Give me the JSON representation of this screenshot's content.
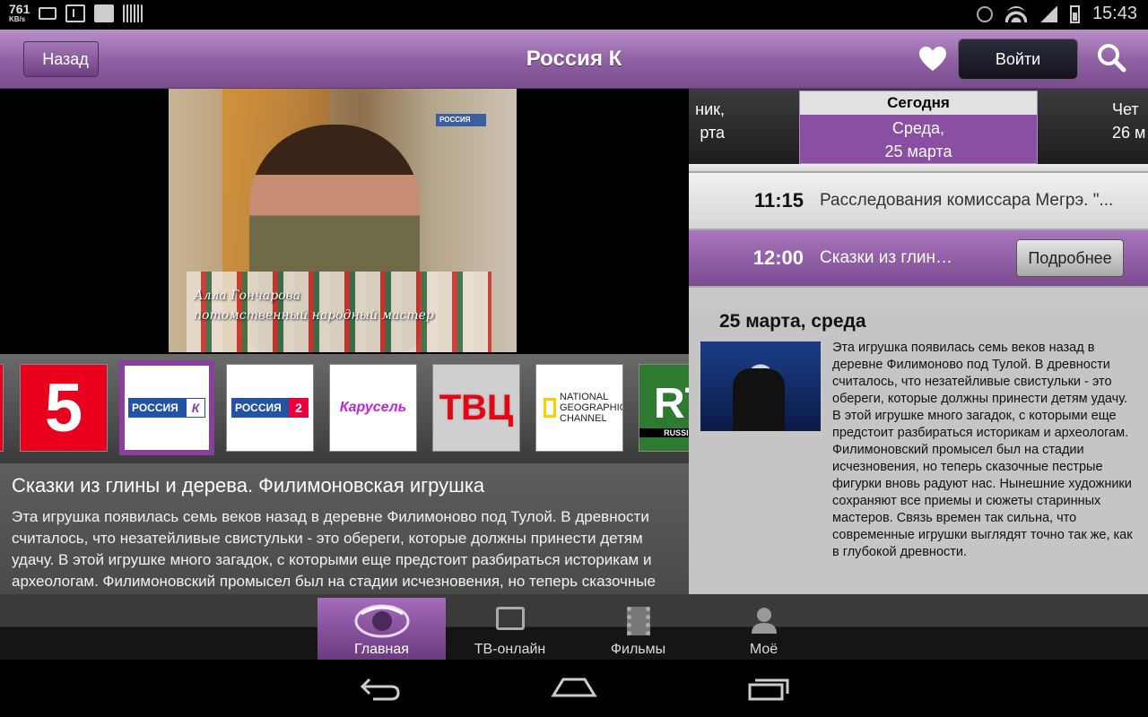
{
  "status_bar": {
    "speed_value": "761",
    "speed_unit": "KB/s",
    "time": "15:43"
  },
  "header": {
    "back_label": "Назад",
    "title": "Россия К",
    "login_label": "Войти"
  },
  "video": {
    "caption_line1": "Алла Гончарова",
    "caption_line2": "потомственный народный мастер",
    "channel_logo": "РОССИЯ"
  },
  "channels": [
    {
      "name": "5",
      "label": "5"
    },
    {
      "name": "russia-k",
      "label": "РОССИЯ",
      "tag": "К"
    },
    {
      "name": "russia-2",
      "label": "РОССИЯ",
      "tag": "2"
    },
    {
      "name": "karusel",
      "label": "Карусель"
    },
    {
      "name": "tvc",
      "label": "ТВ",
      "tag": "Ц"
    },
    {
      "name": "natgeo",
      "label": "NATIONAL GEOGRAPHIC CHANNEL"
    },
    {
      "name": "rt",
      "label": "RT",
      "tag": "RUSSIA T"
    }
  ],
  "description": {
    "title": "Сказки из глины и дерева. Филимоновская игрушка",
    "text": "Эта игрушка появилась семь веков назад в деревне Филимоново под Тулой. В древности считалось, что незатейливые свистульки - это обереги, которые должны принести детям удачу. В этой игрушке много загадок, с которыми еще предстоит разбираться историкам и археологам. Филимоновский промысел был на стадии исчезновения, но теперь сказочные пестрые фигурки вновь радуют нас."
  },
  "days": {
    "prev_line1": "ник,",
    "prev_line2": "рта",
    "today_label": "Сегодня",
    "today_line1": "Среда,",
    "today_line2": "25 марта",
    "next_line1": "Чет",
    "next_line2": "26 м"
  },
  "schedule": [
    {
      "time": "11:15",
      "name": "Расследования комиссара Мегрэ. \"..."
    },
    {
      "time": "12:00",
      "name": "Сказки из глины и...",
      "more": "Подробнее"
    }
  ],
  "detail": {
    "date": "25 марта, среда",
    "text": "Эта игрушка появилась семь веков назад в деревне Филимоново под Тулой. В древности считалось, что незатейливые свистульки - это обереги, которые должны принести детям удачу. В этой игрушке много загадок, с которыми еще предстоит разбираться историкам и археологам. Филимоновский промысел был на стадии исчезновения, но теперь сказочные пестрые фигурки вновь радуют нас. Нынешние художники сохраняют все приемы и сюжеты старинных мастеров. Связь времен так сильна, что современные игрушки выглядят точно так же, как в глубокой древности."
  },
  "tabs": [
    {
      "label": "Главная",
      "icon": "eye-icon",
      "active": true
    },
    {
      "label": "ТВ-онлайн",
      "icon": "tv-icon"
    },
    {
      "label": "Фильмы",
      "icon": "film-icon"
    },
    {
      "label": "Моё",
      "icon": "user-icon"
    }
  ],
  "colors": {
    "accent": "#8a4fa2",
    "header": "#8f5ea3"
  }
}
